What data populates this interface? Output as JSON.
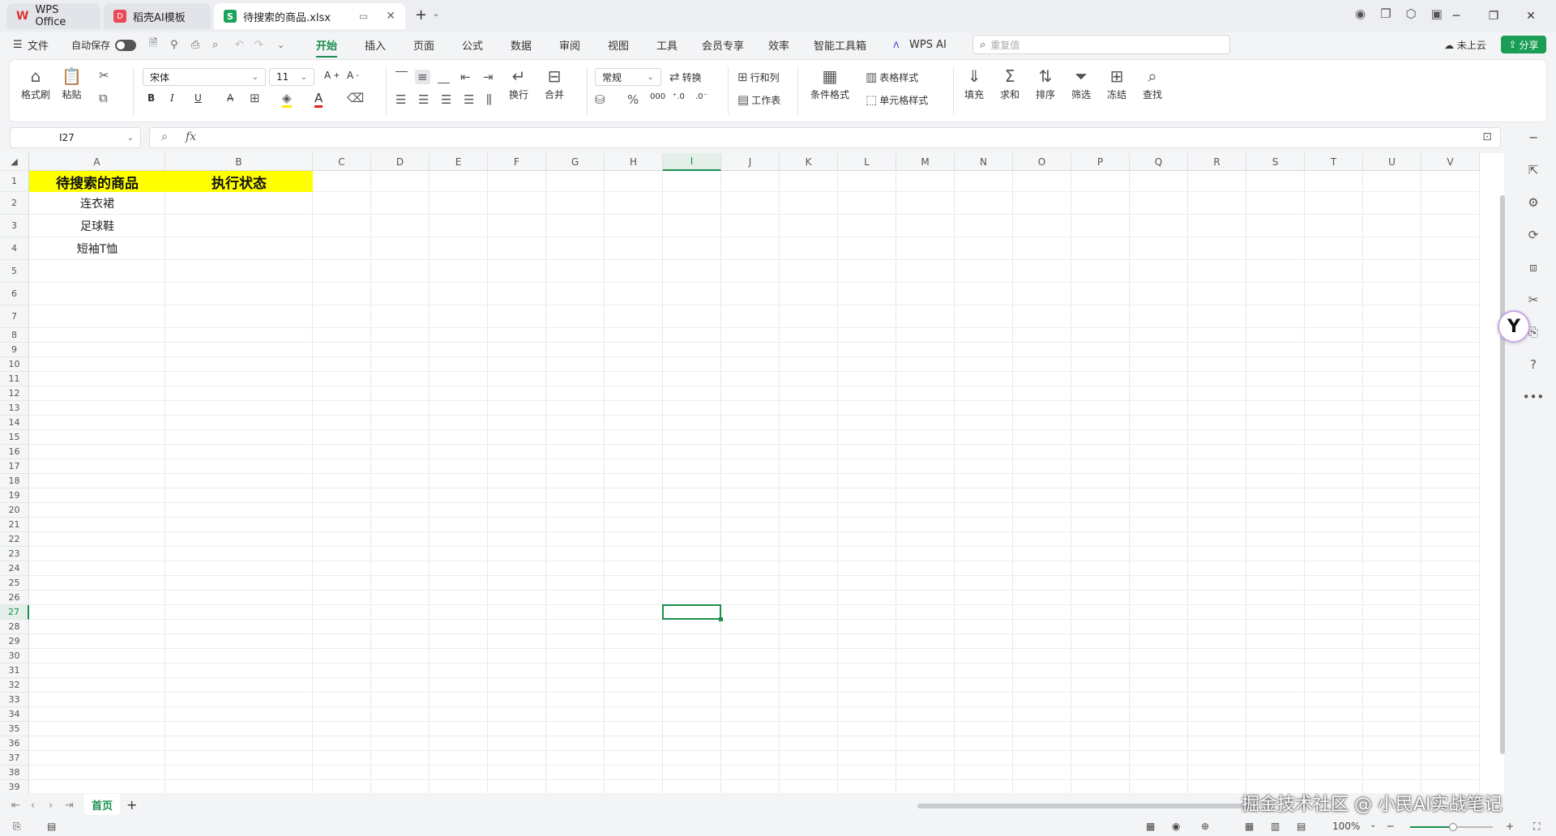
{
  "tabs": [
    {
      "label": "WPS Office",
      "icon": "wps-logo-icon"
    },
    {
      "label": "稻壳AI模板",
      "icon": "docer-logo-icon"
    },
    {
      "label": "待搜索的商品.xlsx",
      "icon": "spreadsheet-logo-icon"
    }
  ],
  "menu": {
    "file": "文件",
    "autosave": "自动保存",
    "items": [
      "开始",
      "插入",
      "页面",
      "公式",
      "数据",
      "审阅",
      "视图",
      "工具",
      "会员专享",
      "效率",
      "智能工具箱",
      "WPS AI"
    ],
    "active": "开始",
    "search_placeholder": "重复值",
    "cloud": "未上云",
    "share": "分享"
  },
  "ribbon": {
    "format_painter": "格式刷",
    "paste": "粘贴",
    "font": "宋体",
    "font_size": "11",
    "bold": "B",
    "italic": "I",
    "underline": "U",
    "wrap": "换行",
    "merge": "合并",
    "number_format": "常规",
    "convert": "转换",
    "rows_cols": "行和列",
    "worksheet": "工作表",
    "cond_format": "条件格式",
    "table_style": "表格样式",
    "cell_style": "单元格样式",
    "fill": "填充",
    "sum": "求和",
    "sort": "排序",
    "filter": "筛选",
    "freeze": "冻结",
    "find": "查找"
  },
  "formula_bar": {
    "cell_ref": "I27",
    "fx": "fx",
    "value": ""
  },
  "sheet": {
    "columns": [
      "A",
      "B",
      "C",
      "D",
      "E",
      "F",
      "G",
      "H",
      "I",
      "J",
      "K",
      "L",
      "M",
      "N",
      "O",
      "P",
      "Q",
      "R",
      "S",
      "T",
      "U",
      "V"
    ],
    "selected_column": "I",
    "selected_row": "27",
    "rows": [
      "1",
      "2",
      "3",
      "4",
      "5",
      "6",
      "7",
      "8",
      "9",
      "10",
      "11",
      "12",
      "13",
      "14",
      "15",
      "16",
      "17",
      "18",
      "19",
      "20",
      "21",
      "22",
      "23",
      "24",
      "25",
      "26",
      "27",
      "28",
      "29",
      "30",
      "31",
      "32",
      "33",
      "34",
      "35",
      "36",
      "37",
      "38",
      "39"
    ],
    "header": {
      "A1": "待搜索的商品",
      "B1": "执行状态",
      "fill_color": "#FFFF00"
    },
    "products": [
      "连衣裙",
      "足球鞋",
      "短袖T恤"
    ]
  },
  "sheet_tabs": {
    "active": "首页",
    "add": "+"
  },
  "status": {
    "zoom": "100%"
  },
  "watermark": "掘金技术社区 @ 小民AI实战笔记",
  "colors": {
    "accent": "#1A8F4E",
    "header_fill": "#FFFF00"
  }
}
